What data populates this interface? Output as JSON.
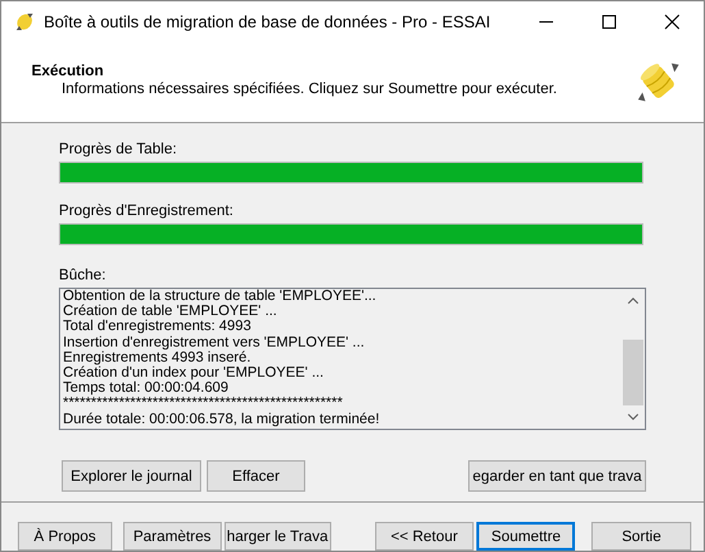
{
  "window": {
    "title": "Boîte à outils de migration de base de données - Pro - ESSAI"
  },
  "header": {
    "title": "Exécution",
    "subtitle": "Informations nécessaires spécifiées. Cliquez sur Soumettre pour exécuter."
  },
  "progress": [
    {
      "label": "Progrès de Table:",
      "level": 1
    },
    {
      "label": "Progrès d'Enregistrement:",
      "level": 1
    }
  ],
  "log": {
    "label": "Bûche:",
    "lines": [
      "Obtention de la structure de table 'EMPLOYEE'...",
      "Création de table 'EMPLOYEE' ...",
      "Total d'enregistrements: 4993",
      "Insertion d'enregistrement vers 'EMPLOYEE' ...",
      "Enregistrements 4993 inseré.",
      "Création d'un index pour 'EMPLOYEE' ...",
      "Temps total: 00:00:04.609",
      "**************************************************",
      "Durée totale: 00:00:06.578, la migration terminée!"
    ]
  },
  "log_buttons": [
    {
      "label": "Explorer le journal"
    },
    {
      "label": "Effacer"
    },
    {
      "label": "egarder en tant que trava"
    }
  ],
  "footer_buttons": [
    {
      "label": "À Propos",
      "focused": false
    },
    {
      "label": "Paramètres",
      "focused": false
    },
    {
      "label": "harger le Trava",
      "focused": false
    },
    {
      "label": "<< Retour",
      "focused": false
    },
    {
      "label": "Soumettre",
      "focused": true
    },
    {
      "label": "Sortie",
      "focused": false
    }
  ]
}
